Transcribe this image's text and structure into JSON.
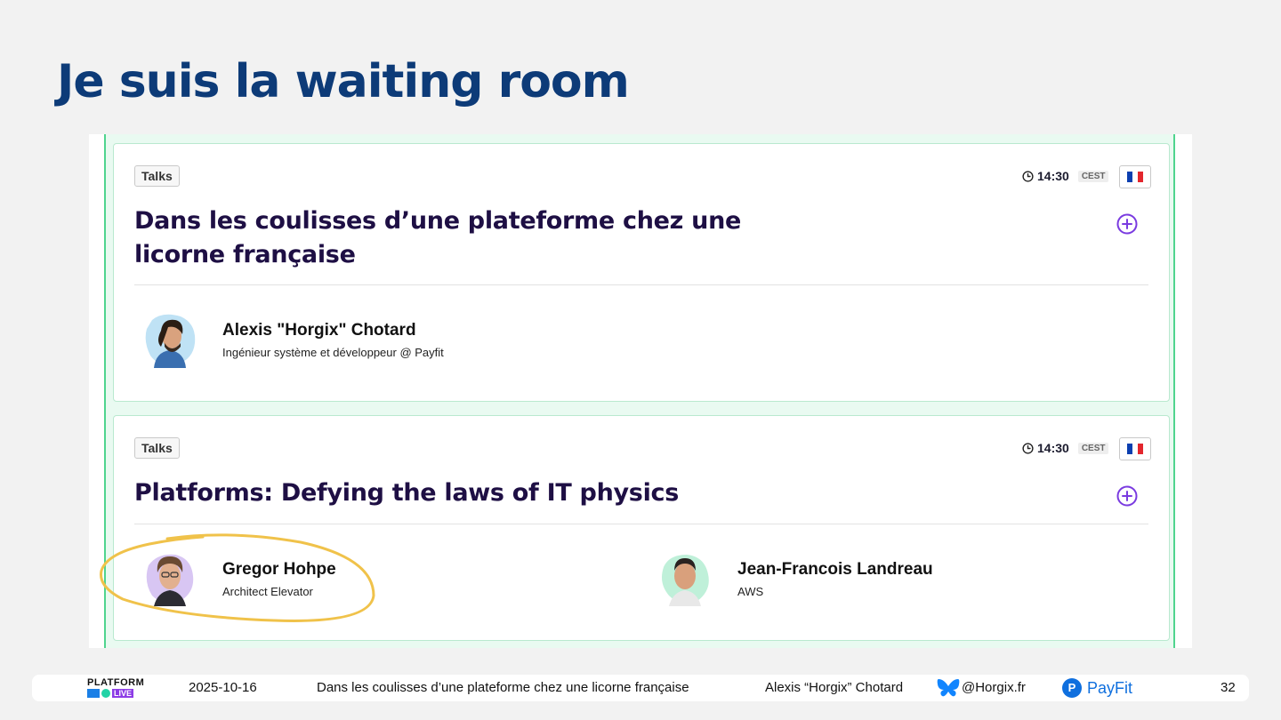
{
  "slide": {
    "title": "Je suis la waiting room"
  },
  "cards": [
    {
      "tag": "Talks",
      "time": "14:30",
      "timezone": "CEST",
      "title": "Dans les coulisses d’une plateforme chez une licorne française",
      "speakers": [
        {
          "name": "Alexis \"Horgix\" Chotard",
          "role": "Ingénieur système et développeur @ Payfit"
        }
      ]
    },
    {
      "tag": "Talks",
      "time": "14:30",
      "timezone": "CEST",
      "title": "Platforms: Defying the laws of IT physics",
      "speakers": [
        {
          "name": "Gregor Hohpe",
          "role": "Architect Elevator"
        },
        {
          "name": "Jean-Francois Landreau",
          "role": "AWS"
        }
      ]
    }
  ],
  "footer": {
    "logo_top": "PLATFORM",
    "logo_live": "LIVE",
    "date": "2025-10-16",
    "talk_title": "Dans les coulisses d’une plateforme chez une licorne française",
    "author": "Alexis “Horgix” Chotard",
    "handle": "@Horgix.fr",
    "company": "PayFit",
    "page": "32"
  },
  "colors": {
    "title": "#0d3b78",
    "accent_green": "#4fd48e",
    "add_icon": "#7a3be0",
    "annotation": "#f0c24a"
  },
  "icons": [
    "clock-icon",
    "french-flag-icon",
    "add-to-schedule-icon",
    "bluesky-icon",
    "payfit-logo"
  ]
}
